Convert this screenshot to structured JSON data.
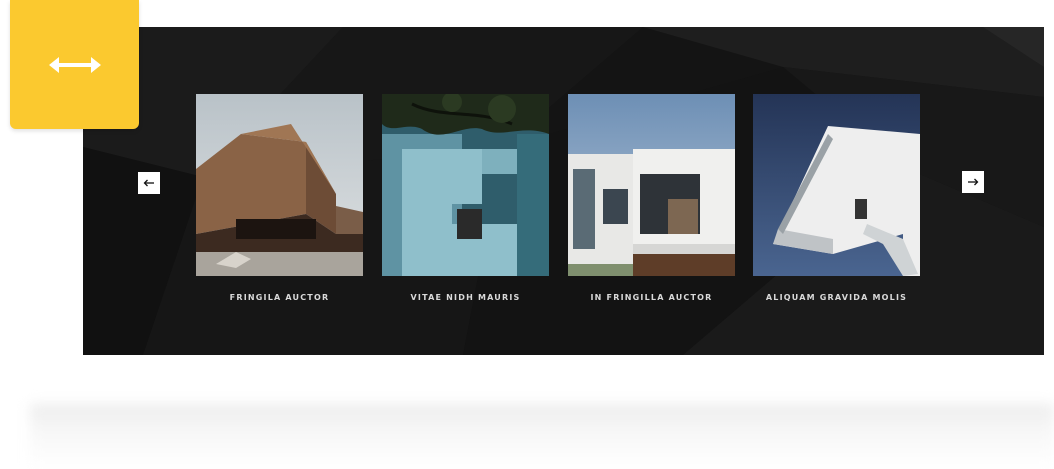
{
  "badge": {
    "icon": "horizontal-resize-icon",
    "color": "#fbc92f"
  },
  "slider": {
    "background_color": "#141414",
    "prev_icon": "arrow-left-icon",
    "next_icon": "arrow-right-icon",
    "cards": [
      {
        "title": "FRINGILA AUCTOR",
        "image": "brown-block-building-photo"
      },
      {
        "title": "VITAE NIDH MAURIS",
        "image": "blue-wall-building-photo"
      },
      {
        "title": "IN FRINGILLA AUCTOR",
        "image": "white-modern-house-photo"
      },
      {
        "title": "ALIQUAM GRAVIDA MOLIS",
        "image": "white-cantilever-building-photo"
      }
    ]
  }
}
